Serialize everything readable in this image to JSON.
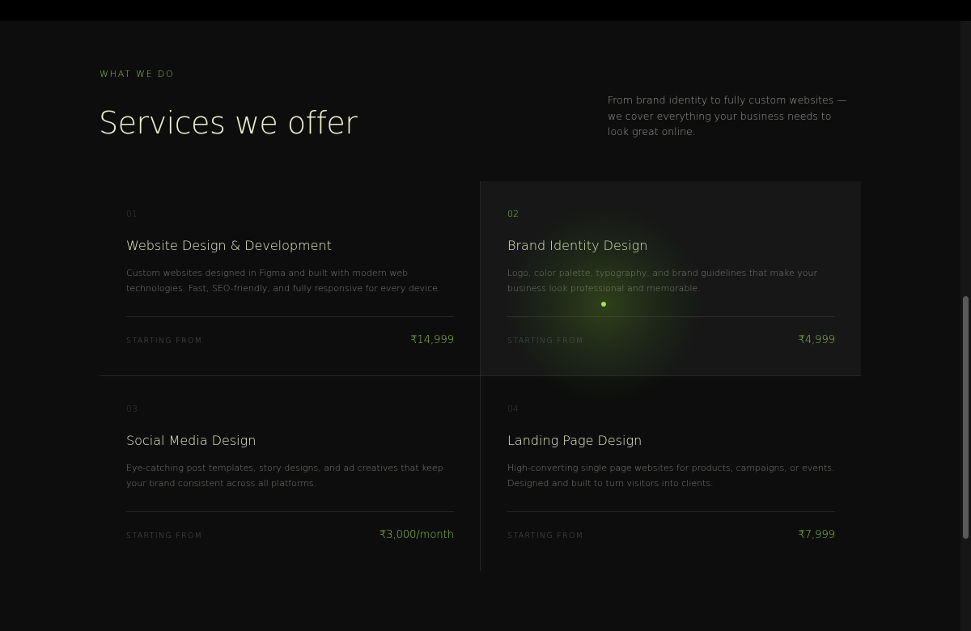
{
  "header": {
    "eyebrow": "WHAT WE DO",
    "title": "Services we offer",
    "intro": "From brand identity to fully custom websites — we cover everything your business needs to look great online."
  },
  "services": [
    {
      "number": "01",
      "title": "Website Design & Development",
      "description": "Custom websites designed in Figma and built with modern web technologies. Fast, SEO-friendly, and fully responsive for every device.",
      "price_label": "STARTING FROM",
      "price": "₹14,999"
    },
    {
      "number": "02",
      "title": "Brand Identity Design",
      "description": "Logo, color palette, typography, and brand guidelines that make your business look professional and memorable.",
      "price_label": "STARTING FROM",
      "price": "₹4,999"
    },
    {
      "number": "03",
      "title": "Social Media Design",
      "description": "Eye-catching post templates, story designs, and ad creatives that keep your brand consistent across all platforms.",
      "price_label": "STARTING FROM",
      "price": "₹3,000/month"
    },
    {
      "number": "04",
      "title": "Landing Page Design",
      "description": "High-converting single page websites for products, campaigns, or events. Designed and built to turn visitors into clients.",
      "price_label": "STARTING FROM",
      "price": "₹7,999"
    }
  ],
  "colors": {
    "accent": "#8fc34a",
    "background": "#0d0d0d",
    "heading": "#eef0c9",
    "hover_card": "#171717"
  }
}
